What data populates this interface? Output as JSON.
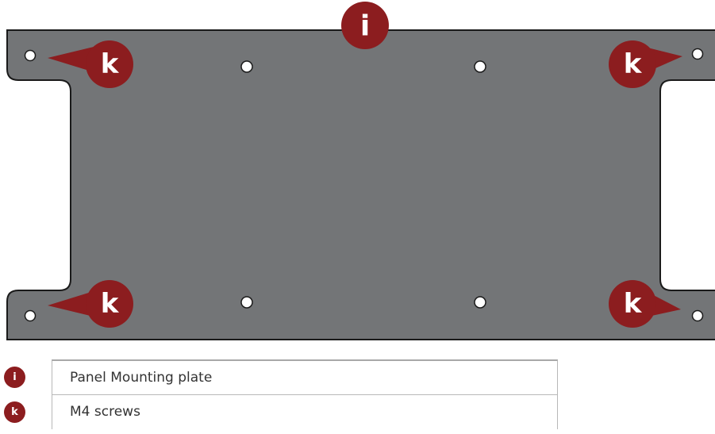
{
  "callouts": {
    "plate": "i",
    "screw": "k"
  },
  "legend": [
    {
      "key": "i",
      "label": "Panel Mounting plate"
    },
    {
      "key": "k",
      "label": "M4 screws"
    }
  ],
  "colors": {
    "plate_fill": "#737577",
    "plate_outline": "#1a1a1a",
    "callout": "#8c1d1f",
    "hole": "#ffffff"
  },
  "icons": {
    "plate": "mounting-plate-shape",
    "hole": "hole-icon",
    "callout": "callout-badge-icon"
  }
}
